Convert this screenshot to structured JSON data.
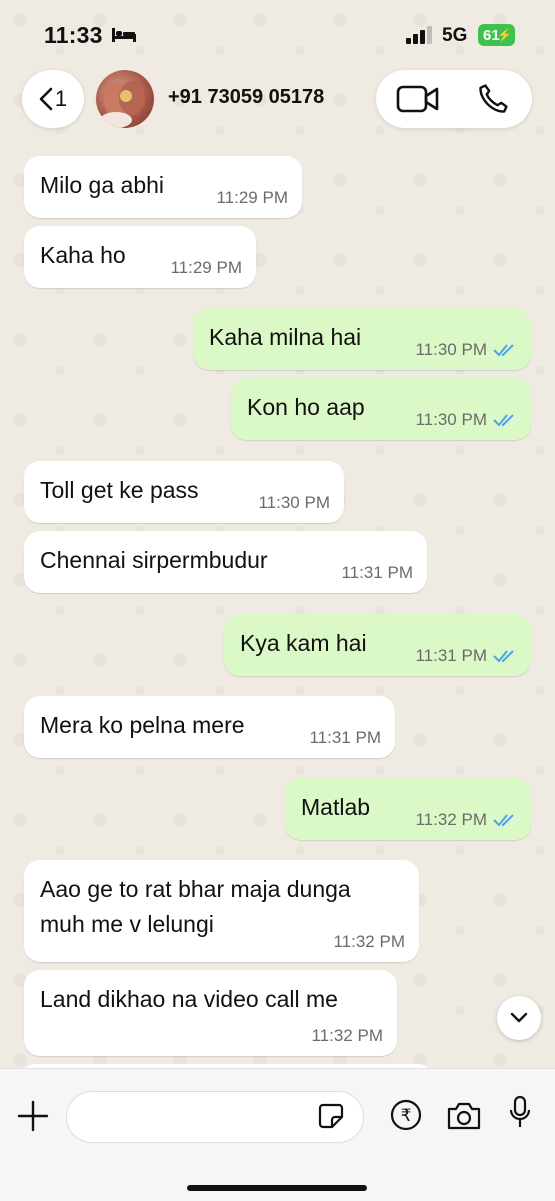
{
  "status_bar": {
    "time": "11:33",
    "network": "5G",
    "battery": "61"
  },
  "header": {
    "back_count": "1",
    "contact": "+91 73059 05178"
  },
  "messages": [
    {
      "text": "Milo ga abhi",
      "time": "11:29 PM",
      "dir": "in"
    },
    {
      "text": "Kaha ho",
      "time": "11:29 PM",
      "dir": "in"
    },
    {
      "text": "Kaha milna hai",
      "time": "11:30 PM",
      "dir": "out"
    },
    {
      "text": "Kon ho aap",
      "time": "11:30 PM",
      "dir": "out"
    },
    {
      "text": "Toll get ke pass",
      "time": "11:30 PM",
      "dir": "in"
    },
    {
      "text": "Chennai sirpermbudur",
      "time": "11:31 PM",
      "dir": "in"
    },
    {
      "text": "Kya kam hai",
      "time": "11:31 PM",
      "dir": "out"
    },
    {
      "text": "Mera ko pelna mere",
      "time": "11:31 PM",
      "dir": "in"
    },
    {
      "text": "Matlab",
      "time": "11:32 PM",
      "dir": "out"
    },
    {
      "text": "Aao ge to rat bhar maja dunga",
      "text2": "muh me v lelungi",
      "time": "11:32 PM",
      "dir": "in"
    },
    {
      "text": "Land dikhao na video call me",
      "time": "11:32 PM",
      "dir": "in"
    }
  ],
  "input": {
    "value": "",
    "placeholder": ""
  },
  "colors": {
    "read_ticks": "#4fa3e8",
    "out_bubble": "#dbf8c7",
    "battery": "#3ec24f"
  },
  "icons": [
    "bed-icon",
    "signal-icon",
    "back-chevron-icon",
    "video-call-icon",
    "phone-call-icon",
    "scroll-down-icon",
    "plus-icon",
    "sticker-icon",
    "rupee-icon",
    "camera-icon",
    "mic-icon"
  ]
}
